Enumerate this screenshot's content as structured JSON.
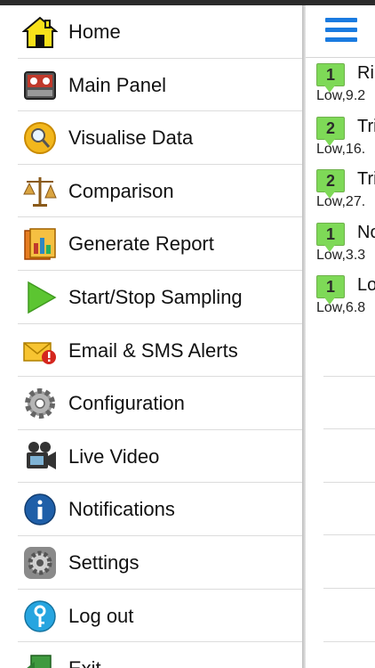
{
  "menu": [
    {
      "label": "Home",
      "icon": "house-icon"
    },
    {
      "label": "Main Panel",
      "icon": "control-panel-icon"
    },
    {
      "label": "Visualise Data",
      "icon": "magnifier-icon"
    },
    {
      "label": "Comparison",
      "icon": "scales-icon"
    },
    {
      "label": "Generate Report",
      "icon": "report-icon"
    },
    {
      "label": "Start/Stop Sampling",
      "icon": "play-icon"
    },
    {
      "label": "Email & SMS Alerts",
      "icon": "mail-alert-icon"
    },
    {
      "label": "Configuration",
      "icon": "gear-icon"
    },
    {
      "label": "Live Video",
      "icon": "camera-icon"
    },
    {
      "label": "Notifications",
      "icon": "info-icon"
    },
    {
      "label": "Settings",
      "icon": "settings-icon"
    },
    {
      "label": "Log out",
      "icon": "key-icon"
    },
    {
      "label": "Exit",
      "icon": "exit-icon"
    }
  ],
  "list": [
    {
      "badge": "1",
      "title": "Ri",
      "sub": "Low,9.2"
    },
    {
      "badge": "2",
      "title": "Tri",
      "sub": "Low,16."
    },
    {
      "badge": "2",
      "title": "Tri",
      "sub": "Low,27."
    },
    {
      "badge": "1",
      "title": "No",
      "sub": "Low,3.3"
    },
    {
      "badge": "1",
      "title": "Lo",
      "sub": "Low,6.8"
    }
  ],
  "colors": {
    "badge": "#7ed957",
    "hamburger": "#1a7be0"
  }
}
